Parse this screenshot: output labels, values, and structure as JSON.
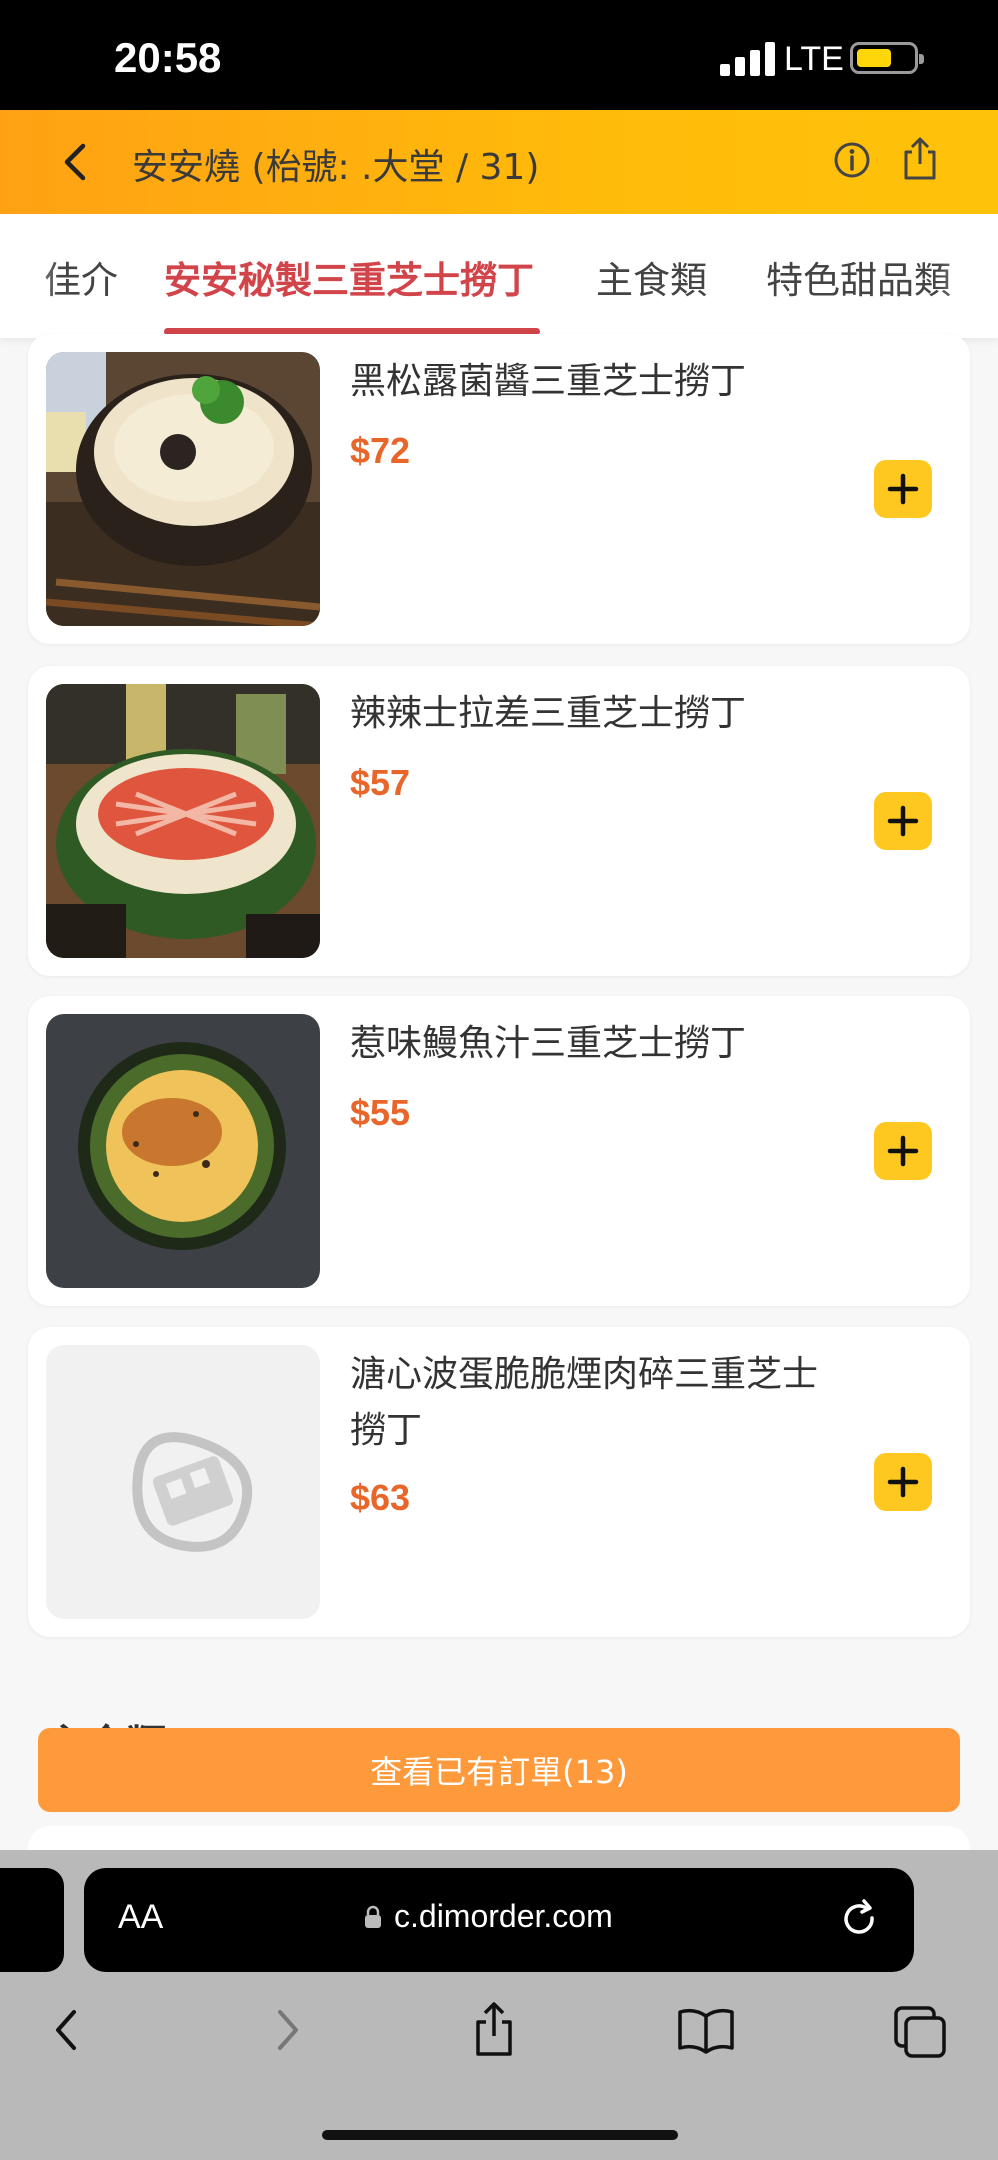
{
  "status": {
    "time": "20:58",
    "network": "LTE"
  },
  "header": {
    "title": "安安燒 (枱號: .大堂 / 31)"
  },
  "tabs": [
    {
      "label": "佳介"
    },
    {
      "label": "安安秘製三重芝士撈丁"
    },
    {
      "label": "主食類"
    },
    {
      "label": "特色甜品類"
    }
  ],
  "items": [
    {
      "name": "黑松露菌醬三重芝士撈丁",
      "price": "$72"
    },
    {
      "name": "辣辣士拉差三重芝士撈丁",
      "price": "$57"
    },
    {
      "name": "惹味鰻魚汁三重芝士撈丁",
      "price": "$55"
    },
    {
      "name": "溏心波蛋脆脆煙肉碎三重芝士撈丁",
      "price": "$63"
    }
  ],
  "next_section": {
    "title": "主食類"
  },
  "order_button": {
    "label": "查看已有訂單(13)"
  },
  "browser": {
    "text_size": "AA",
    "url": "c.dimorder.com"
  },
  "colors": {
    "accent_red": "#d0444a",
    "price_orange": "#e8662a",
    "add_yellow": "#ffc820",
    "order_orange": "#ff9a3c"
  }
}
